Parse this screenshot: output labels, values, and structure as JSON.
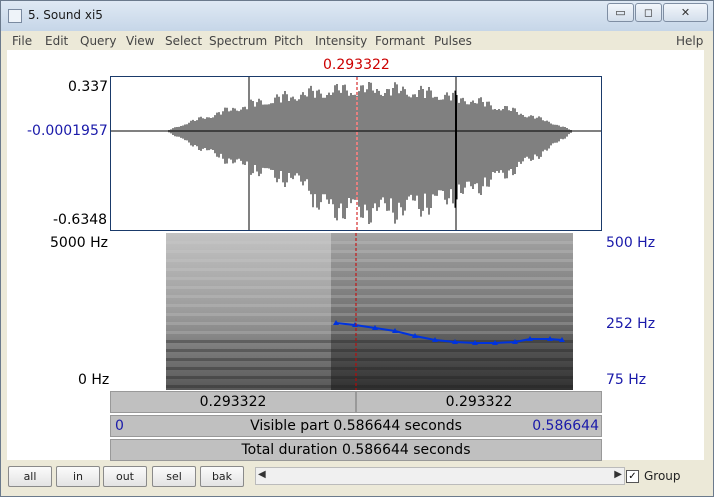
{
  "window": {
    "title": "5. Sound xi5"
  },
  "window_buttons": {
    "minimize": "▭",
    "maximize": "◻",
    "close": "✕"
  },
  "menu": [
    "File",
    "Edit",
    "Query",
    "View",
    "Select",
    "Spectrum",
    "Pitch",
    "Intensity",
    "Formant",
    "Pulses"
  ],
  "menu_help": "Help",
  "cursor": {
    "time": "0.293322"
  },
  "waveform": {
    "max": "0.337",
    "cursor_value": "-0.0001957",
    "min": "-0.6348"
  },
  "spectrogram": {
    "top_freq": "5000 Hz",
    "bottom_freq": "0 Hz"
  },
  "pitch_axis": {
    "top": "500 Hz",
    "middle": "252 Hz",
    "bottom": "75 Hz"
  },
  "bars": {
    "left_time": "0.293322",
    "right_time": "0.293322",
    "visible_start": "0",
    "visible_text": "Visible part 0.586644 seconds",
    "visible_end": "0.586644",
    "total_text": "Total duration 0.586644 seconds"
  },
  "buttons": [
    "all",
    "in",
    "out",
    "sel",
    "bak"
  ],
  "group": {
    "label": "Group",
    "checked": "✓"
  },
  "colors": {
    "cursor": "#cc0000",
    "axis_value": "#1a1aaa",
    "pitch": "#0033dd"
  }
}
